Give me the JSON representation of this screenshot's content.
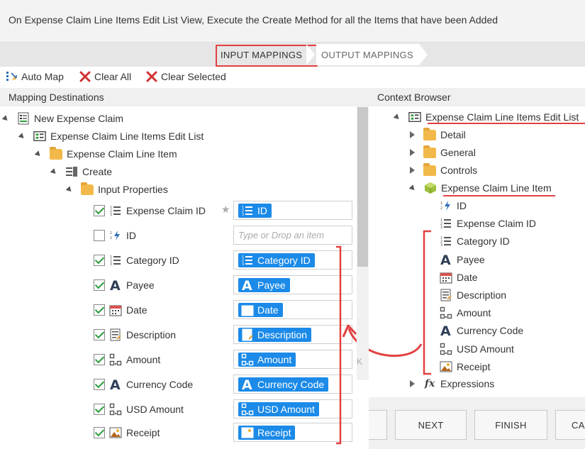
{
  "header": {
    "title": "On Expense Claim Line Items Edit List View, Execute the Create Method for all the Items that have been Added"
  },
  "wizard": {
    "active_step": "INPUT MAPPINGS",
    "next_step": "OUTPUT MAPPINGS"
  },
  "toolbar": {
    "auto_map": "Auto Map",
    "clear_all": "Clear All",
    "clear_selected": "Clear Selected"
  },
  "panels": {
    "left_title": "Mapping Destinations",
    "right_title": "Context Browser"
  },
  "left_tree": {
    "root": "New Expense Claim",
    "list": "Expense Claim Line Items Edit List",
    "item": "Expense Claim Line Item",
    "method": "Create",
    "props_folder": "Input Properties"
  },
  "properties": [
    {
      "label": "Expense Claim ID",
      "checked": true,
      "icon": "number-list-icon",
      "mapped": "ID",
      "mapped_icon": "number-list-icon"
    },
    {
      "label": "ID",
      "checked": false,
      "icon": "auto-number-icon",
      "placeholder": "Type or Drop an item"
    },
    {
      "label": "Category ID",
      "checked": true,
      "icon": "number-list-icon",
      "mapped": "Category ID",
      "mapped_icon": "number-list-icon"
    },
    {
      "label": "Payee",
      "checked": true,
      "icon": "text-a-icon",
      "mapped": "Payee",
      "mapped_icon": "text-a-icon"
    },
    {
      "label": "Date",
      "checked": true,
      "icon": "calendar-icon",
      "mapped": "Date",
      "mapped_icon": "calendar-icon"
    },
    {
      "label": "Description",
      "checked": true,
      "icon": "memo-icon",
      "mapped": "Description",
      "mapped_icon": "memo-icon"
    },
    {
      "label": "Amount",
      "checked": true,
      "icon": "decimal-icon",
      "mapped": "Amount",
      "mapped_icon": "decimal-icon"
    },
    {
      "label": "Currency Code",
      "checked": true,
      "icon": "text-a-icon",
      "mapped": "Currency Code",
      "mapped_icon": "text-a-icon"
    },
    {
      "label": "USD Amount",
      "checked": true,
      "icon": "decimal-icon",
      "mapped": "USD Amount",
      "mapped_icon": "decimal-icon"
    },
    {
      "label": "Receipt",
      "checked": true,
      "icon": "image-icon",
      "mapped": "Receipt",
      "mapped_icon": "image-icon"
    }
  ],
  "context_tree": {
    "root": "Expense Claim Line Items Edit List",
    "folders": [
      "Detail",
      "General",
      "Controls"
    ],
    "item": "Expense Claim Line Item",
    "fields": [
      "ID",
      "Expense Claim ID",
      "Category ID",
      "Payee",
      "Date",
      "Description",
      "Amount",
      "Currency Code",
      "USD Amount",
      "Receipt"
    ],
    "expressions": "Expressions"
  },
  "buttons": {
    "next": "NEXT",
    "finish": "FINISH",
    "cancel": "CA"
  },
  "colors": {
    "accent": "#1b8ae8",
    "highlight": "#e34040",
    "check": "#2d9a3b"
  }
}
